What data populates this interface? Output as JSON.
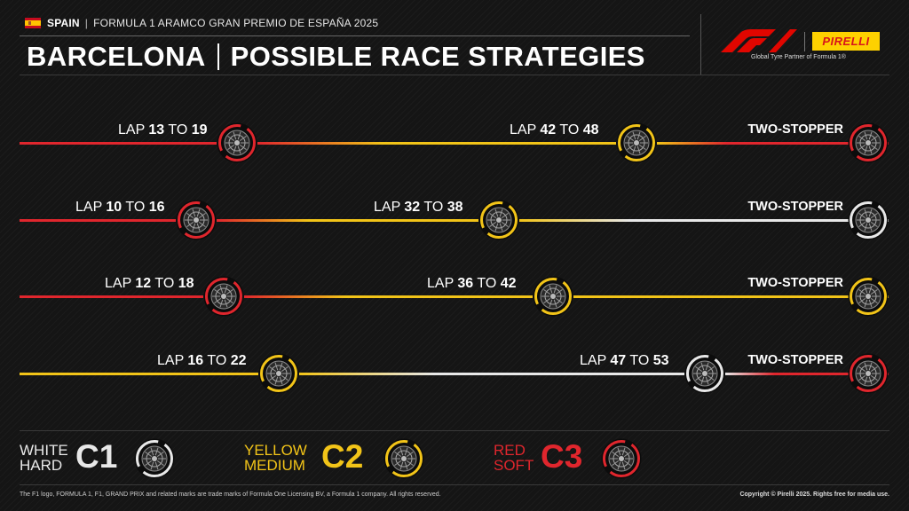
{
  "header": {
    "country": "SPAIN",
    "race": "FORMULA 1 ARAMCO GRAN PREMIO DE ESPAÑA 2025",
    "title_left": "BARCELONA",
    "title_right": "POSSIBLE RACE STRATEGIES",
    "brand_logo": "PIRELLI",
    "partner_text": "Global Tyre Partner of Formula 1®"
  },
  "colors": {
    "hard": "#e8e8e8",
    "medium": "#f2c418",
    "soft": "#e0262d",
    "background": "#151515"
  },
  "strategies": [
    {
      "label": "TWO-STOPPER",
      "stints": [
        "soft",
        "medium",
        "soft"
      ],
      "stop1": {
        "prefix": "LAP",
        "from": "13",
        "to_word": "TO",
        "to": "19"
      },
      "stop2": {
        "prefix": "LAP",
        "from": "42",
        "to_word": "TO",
        "to": "48"
      }
    },
    {
      "label": "TWO-STOPPER",
      "stints": [
        "soft",
        "medium",
        "hard"
      ],
      "stop1": {
        "prefix": "LAP",
        "from": "10",
        "to_word": "TO",
        "to": "16"
      },
      "stop2": {
        "prefix": "LAP",
        "from": "32",
        "to_word": "TO",
        "to": "38"
      }
    },
    {
      "label": "TWO-STOPPER",
      "stints": [
        "soft",
        "medium",
        "medium"
      ],
      "stop1": {
        "prefix": "LAP",
        "from": "12",
        "to_word": "TO",
        "to": "18"
      },
      "stop2": {
        "prefix": "LAP",
        "from": "36",
        "to_word": "TO",
        "to": "42"
      }
    },
    {
      "label": "TWO-STOPPER",
      "stints": [
        "medium",
        "hard",
        "soft"
      ],
      "stop1": {
        "prefix": "LAP",
        "from": "16",
        "to_word": "TO",
        "to": "22"
      },
      "stop2": {
        "prefix": "LAP",
        "from": "47",
        "to_word": "TO",
        "to": "53"
      }
    }
  ],
  "legend": [
    {
      "line1": "WHITE",
      "line2": "HARD",
      "code": "C1",
      "compound": "hard"
    },
    {
      "line1": "YELLOW",
      "line2": "MEDIUM",
      "code": "C2",
      "compound": "medium"
    },
    {
      "line1": "RED",
      "line2": "SOFT",
      "code": "C3",
      "compound": "soft"
    }
  ],
  "footer": {
    "left": "The F1 logo, FORMULA 1, F1, GRAND PRIX and related marks are trade marks of Formula One Licensing BV, a Formula 1 company. All rights reserved.",
    "right": "Copyright © Pirelli 2025. Rights free for media use."
  }
}
